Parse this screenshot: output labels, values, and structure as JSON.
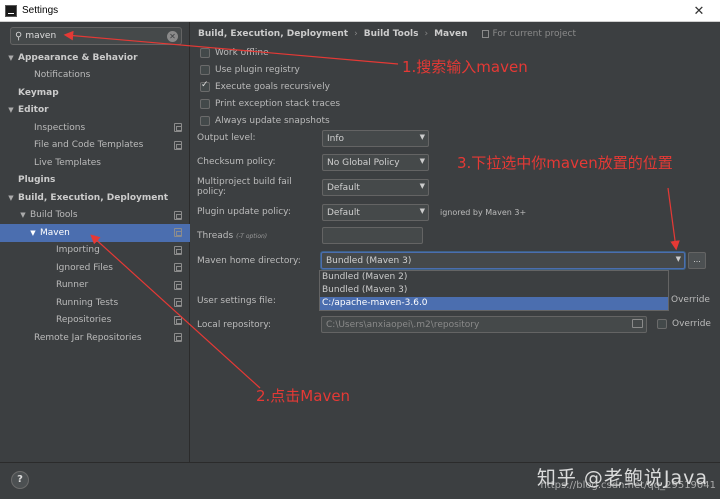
{
  "window": {
    "title": "Settings",
    "close_glyph": "✕"
  },
  "search": {
    "value": "maven",
    "icon": "search-icon",
    "clear_glyph": "✕"
  },
  "tree": [
    {
      "label": "Appearance & Behavior",
      "level": 0,
      "arrow": "▼",
      "bold": true
    },
    {
      "label": "Notifications",
      "level": 2
    },
    {
      "label": "Keymap",
      "level": 0,
      "bold": true
    },
    {
      "label": "Editor",
      "level": 0,
      "arrow": "▼",
      "bold": true
    },
    {
      "label": "Inspections",
      "level": 2,
      "project": true
    },
    {
      "label": "File and Code Templates",
      "level": 2,
      "project": true
    },
    {
      "label": "Live Templates",
      "level": 2
    },
    {
      "label": "Plugins",
      "level": 0,
      "bold": true
    },
    {
      "label": "Build, Execution, Deployment",
      "level": 0,
      "arrow": "▼",
      "bold": true
    },
    {
      "label": "Build Tools",
      "level": 1,
      "arrow": "▼",
      "project": true
    },
    {
      "label": "Maven",
      "level": 2,
      "arrow": "▼",
      "project": true,
      "selected": true
    },
    {
      "label": "Importing",
      "level": 3,
      "project": true
    },
    {
      "label": "Ignored Files",
      "level": 3,
      "project": true
    },
    {
      "label": "Runner",
      "level": 3,
      "project": true
    },
    {
      "label": "Running Tests",
      "level": 3,
      "project": true
    },
    {
      "label": "Repositories",
      "level": 3,
      "project": true
    },
    {
      "label": "Remote Jar Repositories",
      "level": 2,
      "project": true
    }
  ],
  "breadcrumb": {
    "items": [
      "Build, Execution, Deployment",
      "Build Tools",
      "Maven"
    ],
    "separator": "›",
    "for_project": "For current project"
  },
  "checks": [
    {
      "label": "Work offline",
      "checked": false
    },
    {
      "label": "Use plugin registry",
      "checked": false
    },
    {
      "label": "Execute goals recursively",
      "checked": true
    },
    {
      "label": "Print exception stack traces",
      "checked": false
    },
    {
      "label": "Always update snapshots",
      "checked": false
    }
  ],
  "form": {
    "output_level": {
      "label": "Output level:",
      "value": "Info"
    },
    "checksum_policy": {
      "label": "Checksum policy:",
      "value": "No Global Policy"
    },
    "multiproject_policy": {
      "label": "Multiproject build fail policy:",
      "value": "Default"
    },
    "plugin_update_policy": {
      "label": "Plugin update policy:",
      "value": "Default",
      "note": "ignored by Maven 3+"
    },
    "threads": {
      "label": "Threads",
      "hint": "(-T option)",
      "value": ""
    },
    "maven_home": {
      "label": "Maven home directory:",
      "value": "Bundled (Maven 3)",
      "browse": "...",
      "options": [
        "Bundled (Maven 2)",
        "Bundled (Maven 3)",
        "C:/apache-maven-3.6.0"
      ],
      "highlighted_index": 2
    },
    "user_settings": {
      "label": "User settings file:",
      "override": "Override"
    },
    "local_repo": {
      "label": "Local repository:",
      "value": "C:\\Users\\anxiaopei\\.m2\\repository",
      "override": "Override"
    }
  },
  "annotations": {
    "step1": "1.搜索输入maven",
    "step2": "2.点击Maven",
    "step3": "3.下拉选中你maven放置的位置",
    "color": "#e53935"
  },
  "footer": {
    "help": "?",
    "watermark": "知乎 @老鲍说Java",
    "watermark_url": "https://blog.csdn.net/qq_29519041"
  }
}
